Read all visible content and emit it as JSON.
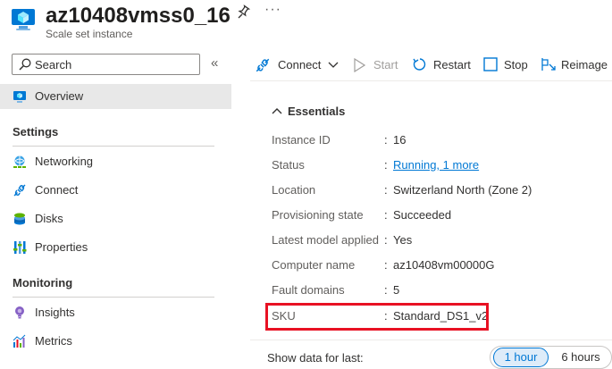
{
  "header": {
    "title": "az10408vmss0_16",
    "subtitle": "Scale set instance",
    "more": "···"
  },
  "search": {
    "placeholder": "Search",
    "collapse": "«"
  },
  "sidebar": {
    "overview": "Overview",
    "settings_head": "Settings",
    "settings_items": [
      "Networking",
      "Connect",
      "Disks",
      "Properties"
    ],
    "monitoring_head": "Monitoring",
    "monitoring_items": [
      "Insights",
      "Metrics"
    ]
  },
  "toolbar": {
    "connect": "Connect",
    "start": "Start",
    "restart": "Restart",
    "stop": "Stop",
    "reimage": "Reimage"
  },
  "essentials": {
    "heading": "Essentials",
    "rows": [
      {
        "label": "Instance ID",
        "value": "16"
      },
      {
        "label": "Status",
        "value": "Running, 1 more"
      },
      {
        "label": "Location",
        "value": "Switzerland North (Zone 2)"
      },
      {
        "label": "Provisioning state",
        "value": "Succeeded"
      },
      {
        "label": "Latest model applied",
        "value": "Yes"
      },
      {
        "label": "Computer name",
        "value": "az10408vm00000G"
      },
      {
        "label": "Fault domains",
        "value": "5"
      },
      {
        "label": "SKU",
        "value": "Standard_DS1_v2"
      }
    ]
  },
  "timerange": {
    "label": "Show data for last:",
    "options": [
      "1 hour",
      "6 hours"
    ],
    "selected": "1 hour"
  },
  "colors": {
    "accent": "#0078d4",
    "highlight": "#e81123"
  }
}
